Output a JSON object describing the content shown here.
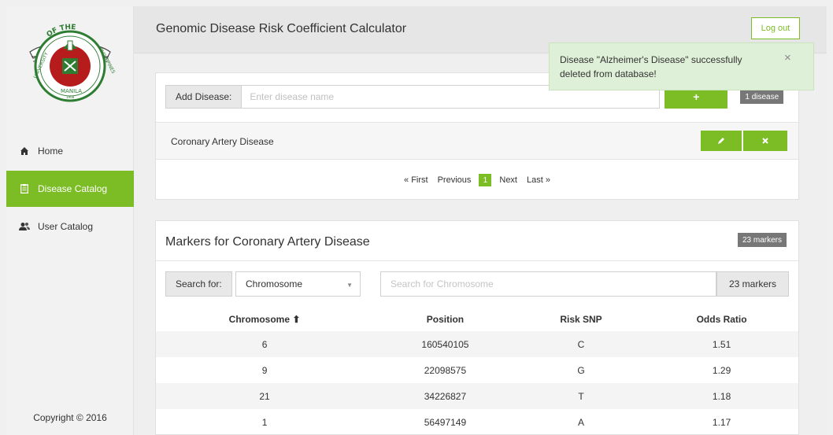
{
  "app": {
    "title": "Genomic Disease Risk Coefficient Calculator",
    "logout_label": "Log out"
  },
  "sidebar": {
    "items": [
      {
        "label": "Home",
        "icon": "home-icon"
      },
      {
        "label": "Disease Catalog",
        "icon": "clipboard-icon",
        "active": true
      },
      {
        "label": "User Catalog",
        "icon": "users-icon"
      }
    ],
    "copyright": "Copyright © 2016"
  },
  "logo": {
    "top_text": "OF THE",
    "left_text": "UNIVERSITY",
    "right_text": "PHILIPPINES",
    "bottom_text": "MANILA",
    "year": "1908"
  },
  "add_disease": {
    "label": "Add Disease:",
    "placeholder": "Enter disease name",
    "add_button": "+",
    "count_badge": "1 disease"
  },
  "diseases": [
    {
      "name": "Coronary Artery Disease",
      "edit_icon": "pencil-icon",
      "delete_icon": "close-icon"
    }
  ],
  "pagination": {
    "first": "« First",
    "previous": "Previous",
    "current": "1",
    "next": "Next",
    "last": "Last »"
  },
  "markers": {
    "title": "Markers for Coronary Artery Disease",
    "count_badge": "23 markers",
    "search_label": "Search for:",
    "search_field": "Chromosome",
    "search_placeholder": "Search for Chromosome",
    "search_count": "23 markers",
    "columns": [
      "Chromosome ⬆",
      "Position",
      "Risk SNP",
      "Odds Ratio"
    ],
    "rows": [
      [
        "6",
        "160540105",
        "C",
        "1.51"
      ],
      [
        "9",
        "22098575",
        "G",
        "1.29"
      ],
      [
        "21",
        "34226827",
        "T",
        "1.18"
      ],
      [
        "1",
        "56497149",
        "A",
        "1.17"
      ]
    ]
  },
  "toast": {
    "message": "Disease \"Alzheimer's Disease\" successfully deleted from database!",
    "close": "×"
  },
  "colors": {
    "accent": "#7cbd26",
    "badge": "#777777",
    "toast_bg": "#dff0d8"
  }
}
